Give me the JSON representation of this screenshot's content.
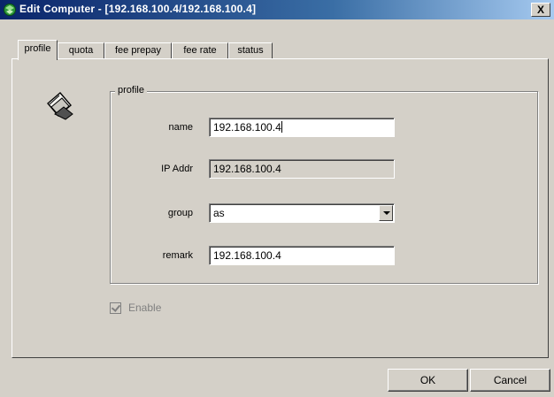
{
  "window": {
    "title": "Edit Computer - [192.168.100.4/192.168.100.4]",
    "close_label": "X"
  },
  "tabs": [
    {
      "label": "profile",
      "active": true
    },
    {
      "label": "quota",
      "active": false
    },
    {
      "label": "fee prepay",
      "active": false
    },
    {
      "label": "fee rate",
      "active": false
    },
    {
      "label": "status",
      "active": false
    }
  ],
  "profile": {
    "group_title": "profile",
    "name_label": "name",
    "name_value": "192.168.100.4",
    "ip_label": "IP Addr",
    "ip_value": "192.168.100.4",
    "group_label": "group",
    "group_value": "as",
    "remark_label": "remark",
    "remark_value": "192.168.100.4",
    "enable_label": "Enable",
    "enable_checked": true
  },
  "buttons": {
    "ok": "OK",
    "cancel": "Cancel"
  }
}
